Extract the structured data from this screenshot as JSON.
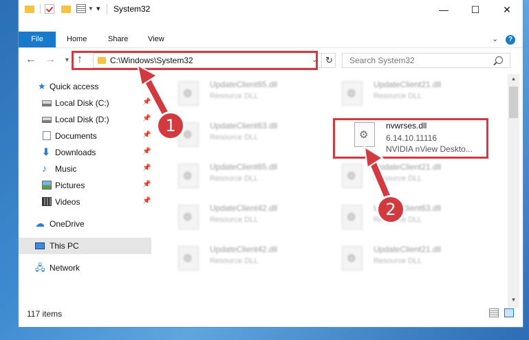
{
  "window": {
    "title": "System32",
    "controls": {
      "minimize": "—",
      "maximize": "☐",
      "close": "✕"
    }
  },
  "ribbon": {
    "tabs": [
      "File",
      "Home",
      "Share",
      "View"
    ],
    "help": "?"
  },
  "nav": {
    "address": "C:\\Windows\\System32",
    "search_placeholder": "Search System32"
  },
  "sidebar": {
    "items": [
      {
        "label": "Quick access",
        "icon": "star-icon"
      },
      {
        "label": "Local Disk (C:)",
        "icon": "disk-icon"
      },
      {
        "label": "Local Disk (D:)",
        "icon": "disk-icon"
      },
      {
        "label": "Documents",
        "icon": "documents-icon"
      },
      {
        "label": "Downloads",
        "icon": "download-icon"
      },
      {
        "label": "Music",
        "icon": "music-icon"
      },
      {
        "label": "Pictures",
        "icon": "pictures-icon"
      },
      {
        "label": "Videos",
        "icon": "videos-icon"
      },
      {
        "label": "OneDrive",
        "icon": "cloud-icon"
      },
      {
        "label": "This PC",
        "icon": "computer-icon"
      },
      {
        "label": "Network",
        "icon": "network-icon"
      }
    ],
    "selected": "This PC"
  },
  "files": [
    {
      "name": "UpdateClient65.dll",
      "type": "Resource DLL"
    },
    {
      "name": "UpdateClient21.dll",
      "type": "Resource DLL"
    },
    {
      "name": "UpdateClient63.dll",
      "type": "Resource DLL"
    },
    {
      "name": "nvwrses.dll",
      "version": "6.14.10.11116",
      "description": "NVIDIA nView Deskto..."
    },
    {
      "name": "UpdateClient65.dll",
      "type": "Resource DLL"
    },
    {
      "name": "UpdateClient21.dll",
      "type": "Resource DLL"
    },
    {
      "name": "UpdateClient42.dll",
      "type": "Resource DLL"
    },
    {
      "name": "UpdateClient63.dll",
      "type": "Resource DLL"
    },
    {
      "name": "UpdateClient42.dll",
      "type": "Resource DLL"
    },
    {
      "name": "UpdateClient21.dll",
      "type": "Resource DLL"
    }
  ],
  "status": {
    "count": "117 items"
  },
  "annotations": {
    "step1": "1",
    "step2": "2",
    "color": "#d33a3f"
  }
}
